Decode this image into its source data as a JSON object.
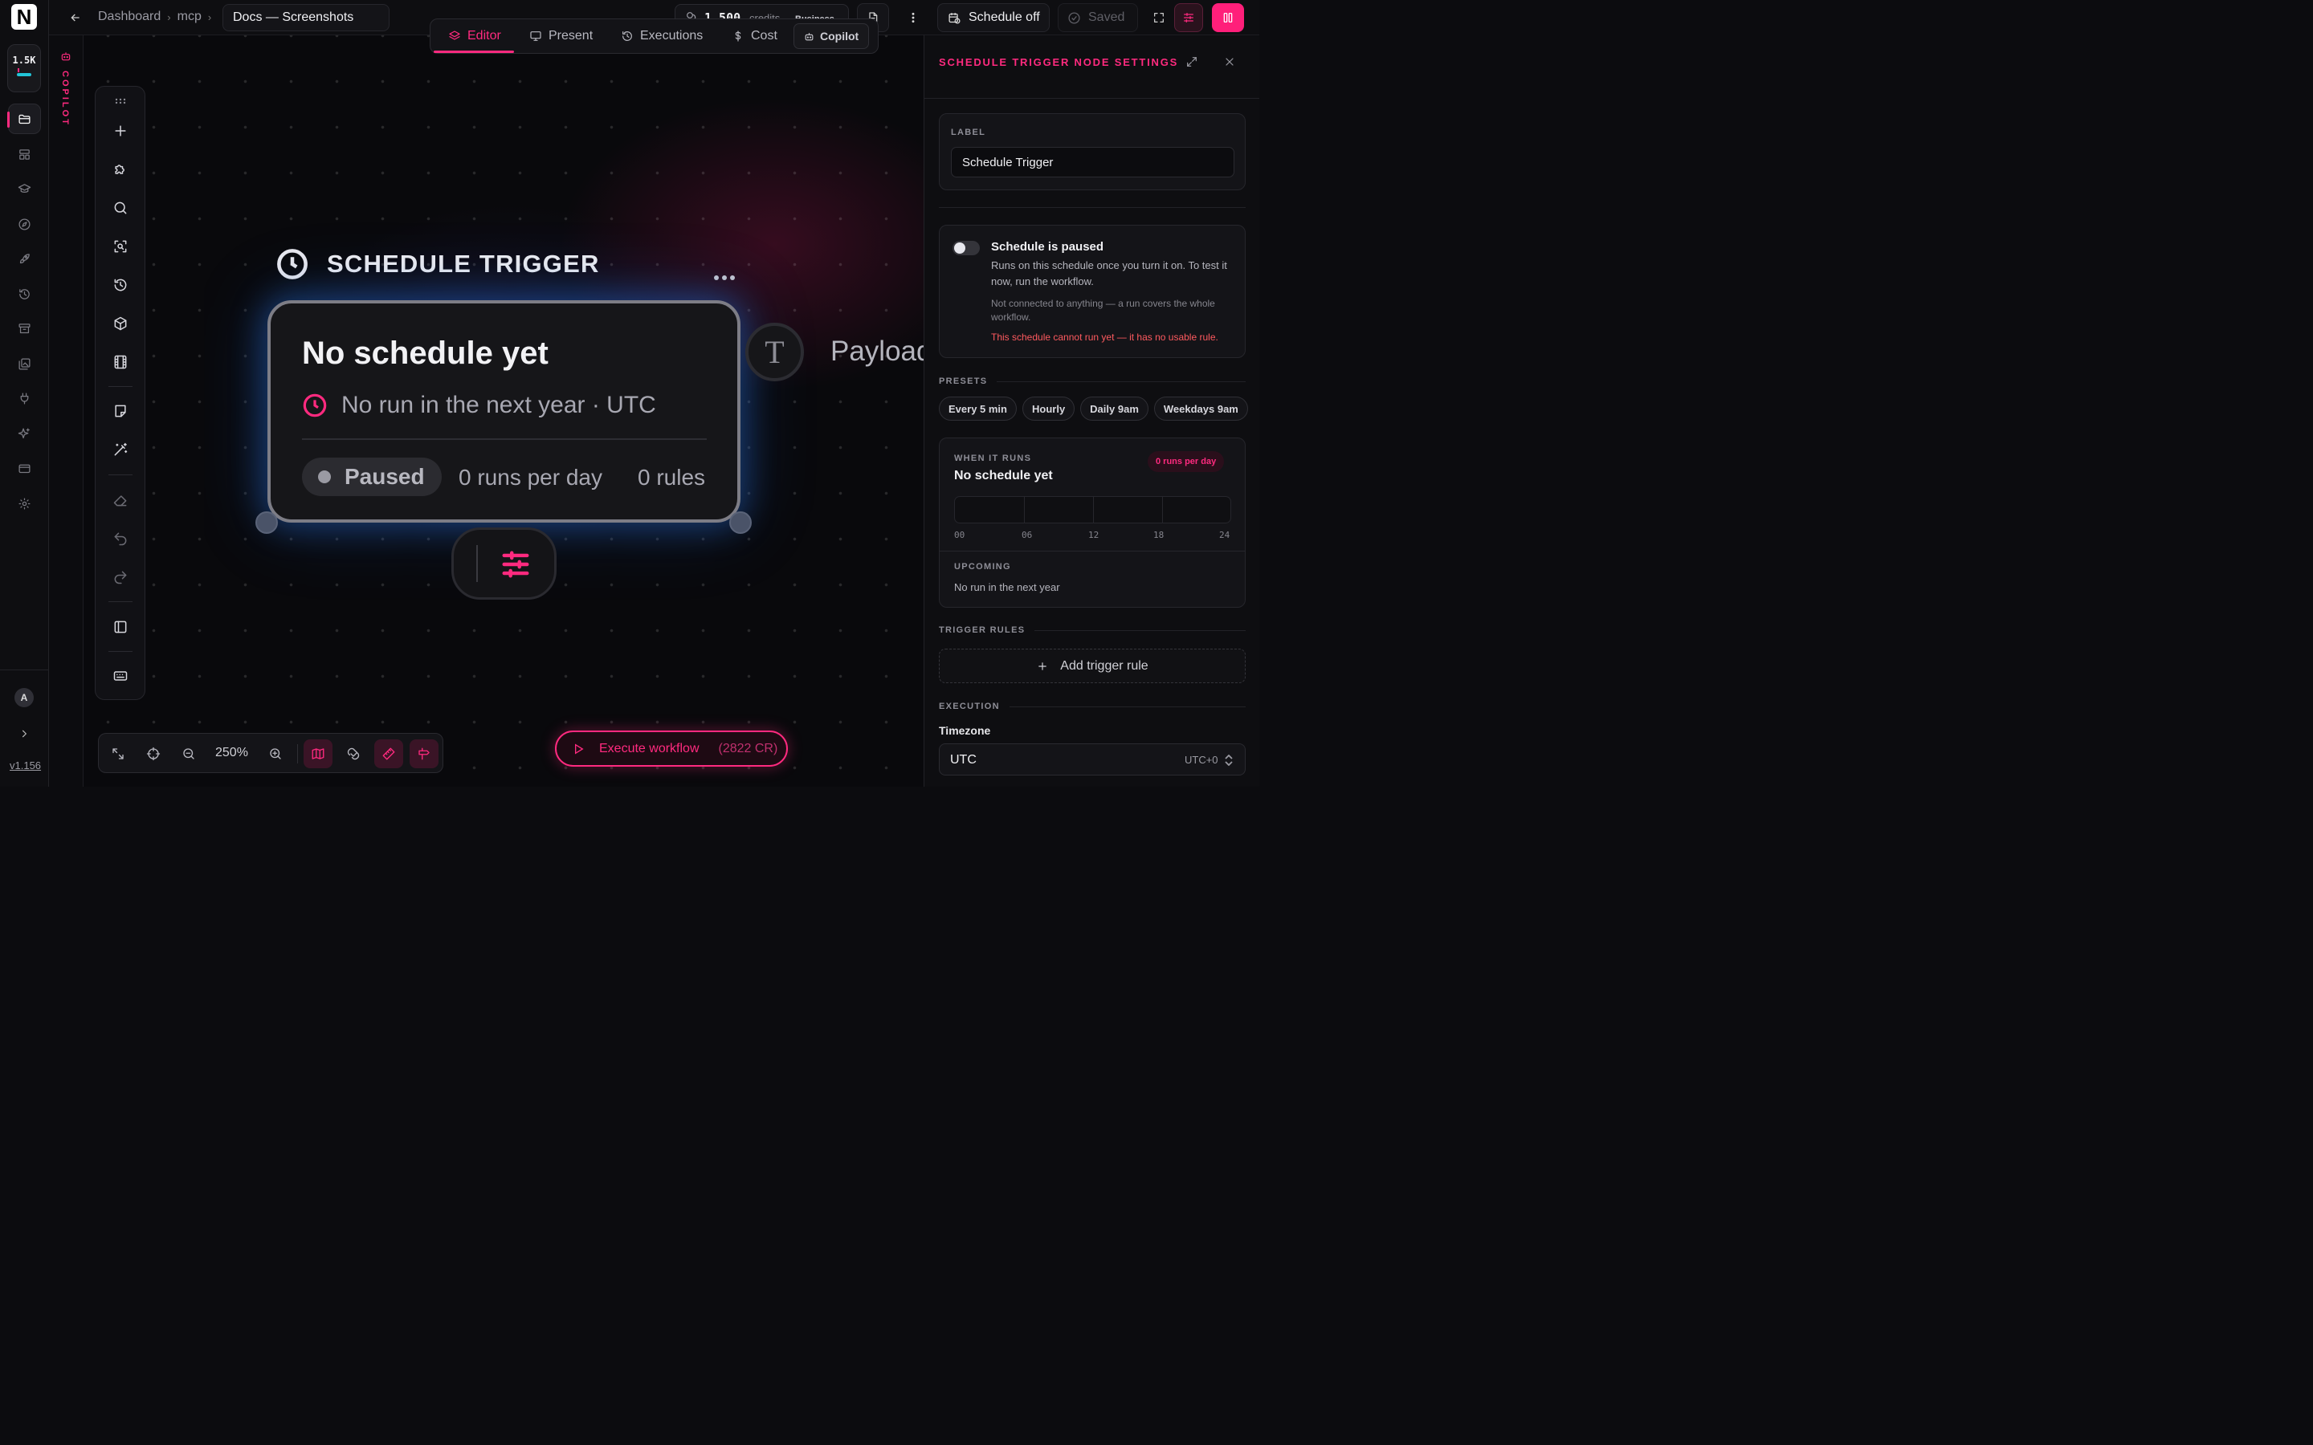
{
  "app": {
    "logo_letter": "N",
    "credits_short": "1.5K",
    "version": "v1.156",
    "avatar_initial": "A",
    "accent_color": "#ff2a7f",
    "rail_icons": [
      "folder-icon",
      "layout-icon",
      "graduation-cap-icon",
      "compass-icon",
      "rocket-icon",
      "history-icon",
      "archive-icon",
      "gallery-icon",
      "plug-icon",
      "sparkles-icon",
      "card-icon",
      "gear-icon"
    ]
  },
  "copilot_strip": {
    "label": "COPILOT"
  },
  "topbar": {
    "breadcrumb": [
      "Dashboard",
      "mcp"
    ],
    "doc_title": "Docs — Screenshots",
    "credits_amount": "1,500",
    "credits_unit": "credits",
    "plan": "Business",
    "schedule_label": "Schedule off",
    "saved_label": "Saved"
  },
  "tabs": {
    "editor": "Editor",
    "present": "Present",
    "executions": "Executions",
    "cost": "Cost",
    "copilot": "Copilot",
    "active": "editor"
  },
  "node": {
    "type_title": "SCHEDULE TRIGGER",
    "title": "No schedule yet",
    "next_run": "No run in the next year · UTC",
    "status": "Paused",
    "runs_per_day": "0 runs per day",
    "rules": "0 rules"
  },
  "payload_node": {
    "icon_letter": "T",
    "label": "Payload"
  },
  "canvas_controls": {
    "zoom": "250%",
    "execute_label": "Execute workflow",
    "execute_cost": "(2822 CR)"
  },
  "panel": {
    "title": "SCHEDULE TRIGGER NODE SETTINGS",
    "label_kicker": "LABEL",
    "label_value": "Schedule Trigger",
    "status_title": "Schedule is paused",
    "status_text": "Runs on this schedule once you turn it on. To test it now, run the workflow.",
    "status_note": "Not connected to anything — a run covers the whole workflow.",
    "status_error": "This schedule cannot run yet — it has no usable rule.",
    "schedule_enabled": false,
    "presets_heading": "PRESETS",
    "presets": [
      "Every 5 min",
      "Hourly",
      "Daily 9am",
      "Weekdays 9am"
    ],
    "when_kicker": "WHEN IT RUNS",
    "when_title": "No schedule yet",
    "when_badge": "0 runs per day",
    "timeline_labels": [
      "00",
      "06",
      "12",
      "18",
      "24"
    ],
    "upcoming_kicker": "UPCOMING",
    "upcoming_value": "No run in the next year",
    "rules_heading": "TRIGGER RULES",
    "add_rule_label": "Add trigger rule",
    "execution_heading": "EXECUTION",
    "timezone_label": "Timezone",
    "timezone_value": "UTC",
    "timezone_offset": "UTC+0"
  }
}
